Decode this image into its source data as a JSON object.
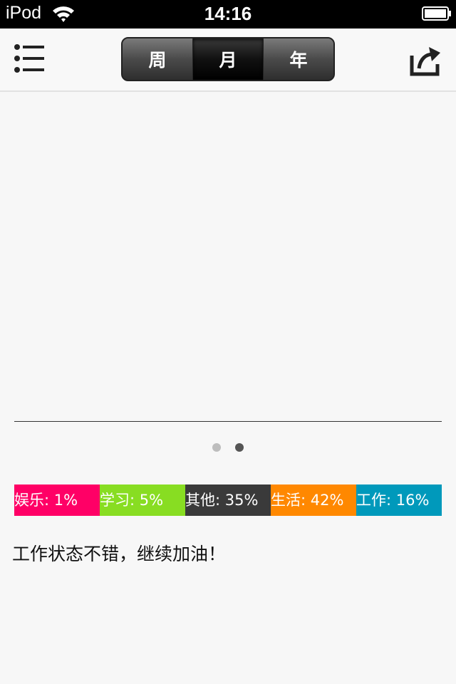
{
  "status_bar": {
    "carrier": "iPod",
    "time": "14:16"
  },
  "nav": {
    "menu_icon": "list-menu-icon",
    "share_icon": "share-icon",
    "segments": [
      {
        "label": "周",
        "selected": false
      },
      {
        "label": "月",
        "selected": true
      },
      {
        "label": "年",
        "selected": false
      }
    ]
  },
  "pager": {
    "count": 2,
    "current": 2,
    "active_color": "#555555",
    "inactive_color": "#bdbdbd"
  },
  "chart_data": {
    "type": "bar",
    "categories": [
      "娱乐",
      "学习",
      "其他",
      "生活",
      "工作"
    ],
    "values": [
      1,
      5,
      35,
      42,
      16
    ],
    "labels": [
      "娱乐: 1%",
      "学习: 5%",
      "其他: 35%",
      "生活: 42%",
      "工作: 16%"
    ],
    "colors": [
      "#ff0066",
      "#88dd22",
      "#3a3a3a",
      "#ff8800",
      "#0099bb"
    ]
  },
  "message": "工作状态不错，继续加油！"
}
